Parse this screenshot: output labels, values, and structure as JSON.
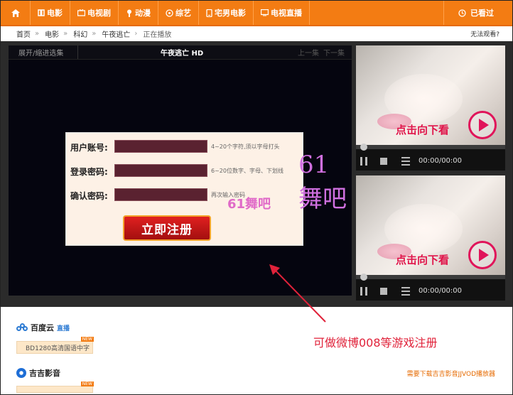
{
  "nav": {
    "items": [
      {
        "label": "电影",
        "icon": "film-icon"
      },
      {
        "label": "电视剧",
        "icon": "tv-icon"
      },
      {
        "label": "动漫",
        "icon": "anime-icon"
      },
      {
        "label": "综艺",
        "icon": "variety-icon"
      },
      {
        "label": "宅男电影",
        "icon": "phone-icon"
      },
      {
        "label": "电视直播",
        "icon": "monitor-icon"
      }
    ],
    "history_label": "已看过"
  },
  "breadcrumb": {
    "items": [
      "首页",
      "电影",
      "科幻",
      "午夜逃亡"
    ],
    "current": "正在播放",
    "right_text": "无法观看?"
  },
  "player": {
    "toggle_label": "展开/缩进选集",
    "title": "午夜逃亡 HD",
    "prev_label": "上一集",
    "next_label": "下一集"
  },
  "register": {
    "username_label": "用户账号:",
    "username_hint": "4~20个字符,须以字母打头",
    "password_label": "登录密码:",
    "password_hint": "6~20位数字、字母、下划线",
    "confirm_label": "确认密码:",
    "confirm_hint": "再次输入密码",
    "submit_label": "立即注册",
    "watermark_small": "61舞吧",
    "watermark_big": "61舞吧"
  },
  "ads": [
    {
      "cta": "点击向下看",
      "time": "00:00/00:00"
    },
    {
      "cta": "点击向下看",
      "time": "00:00/00:00"
    }
  ],
  "bottom": {
    "baidu_name": "百度云",
    "baidu_live": "直播",
    "baidu_tag": "BD1280高清国语中字",
    "jj_name": "吉吉影音",
    "new_badge": "NEW",
    "download_note": "需要下载吉吉影音JJVOD播放器"
  },
  "annotation": {
    "text": "可做微博008等游戏注册"
  },
  "colors": {
    "nav_bg": "#f37c13",
    "accent_red": "#e0223a",
    "cta_pink": "#e0144a"
  }
}
